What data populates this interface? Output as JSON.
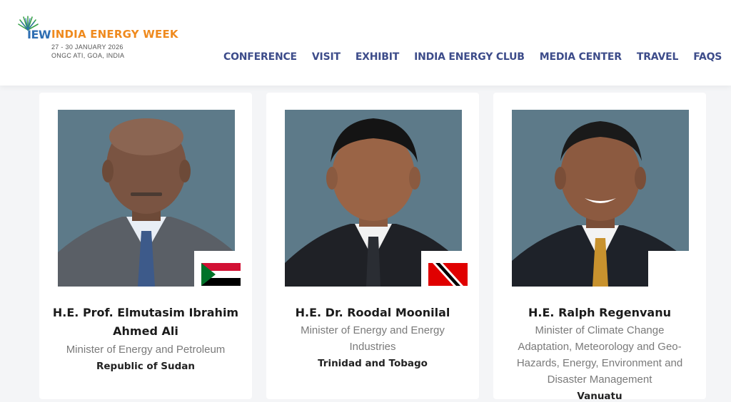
{
  "brand": {
    "short": "IEW",
    "name": "INDIA ENERGY WEEK",
    "dates": "27 - 30 JANUARY 2026",
    "venue": "ONGC ATI, GOA, INDIA",
    "colors": {
      "blue": "#2f6fb3",
      "orange": "#ef8a1e",
      "green": "#3aa24a"
    }
  },
  "nav": {
    "items": [
      "CONFERENCE",
      "VISIT",
      "EXHIBIT",
      "INDIA ENERGY CLUB",
      "MEDIA CENTER",
      "TRAVEL",
      "FAQS"
    ],
    "color": "#3d4c8a"
  },
  "speakers": [
    {
      "name_line1": "H.E. Prof. Elmutasim Ibrahim",
      "name_line2": "Ahmed Ali",
      "role": "Minister of Energy and Petroleum",
      "country": "Republic of Sudan",
      "flag": "sudan-flag"
    },
    {
      "name_line1": "H.E. Dr. Roodal Moonilal",
      "role_line1": "Minister of Energy and Energy",
      "role_line2": "Industries",
      "country": "Trinidad and Tobago",
      "flag": "trinidad-flag"
    },
    {
      "name_line1": "H.E. Ralph Regenvanu",
      "role_line1": "Minister of Climate Change",
      "role_line2": "Adaptation, Meteorology and Geo-",
      "role_line3": "Hazards, Energy, Environment and",
      "role_line4": "Disaster Management",
      "country": "Vanuatu",
      "flag": "vanuatu-flag"
    }
  ],
  "photo_bg": "#5d7a89"
}
